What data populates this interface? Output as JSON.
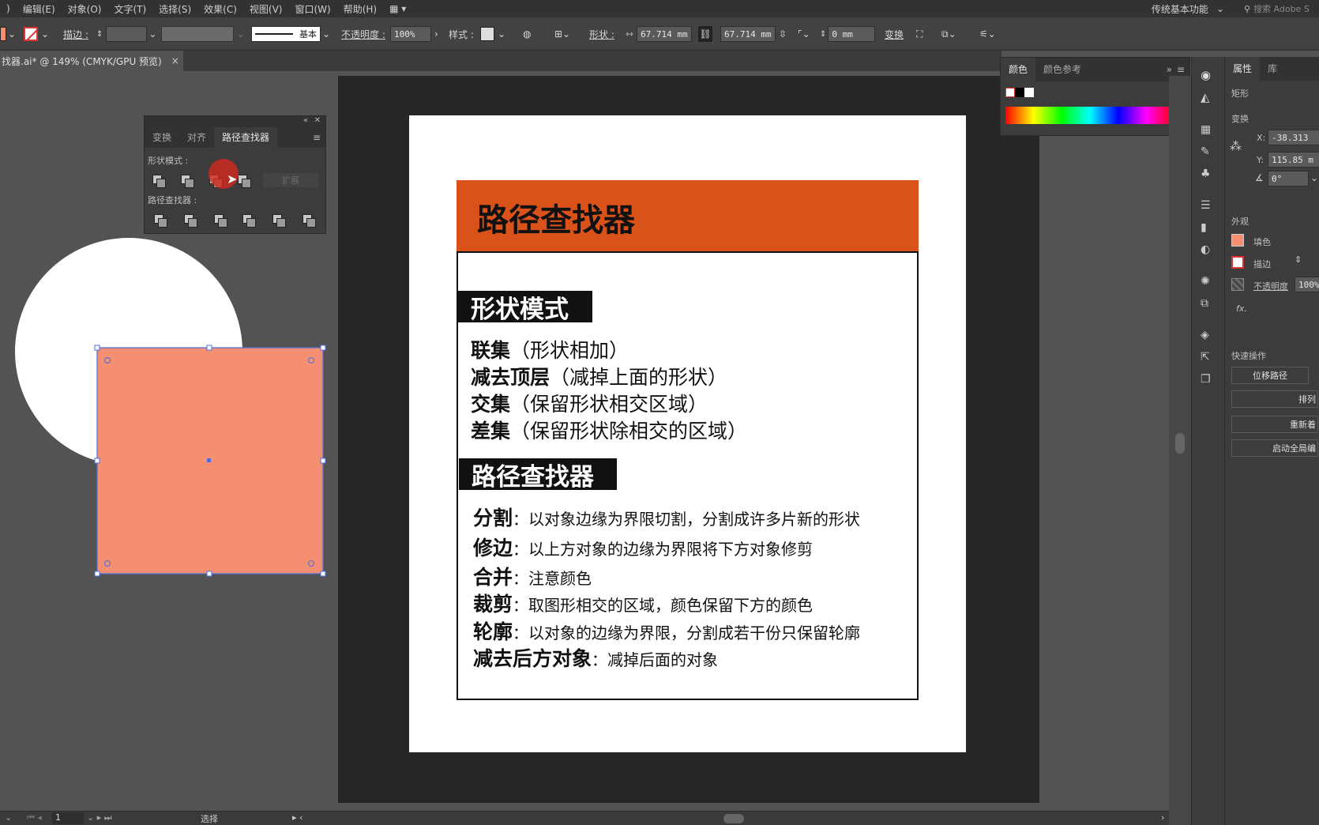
{
  "menubar": {
    "items": [
      ")",
      "编辑(E)",
      "对象(O)",
      "文字(T)",
      "选择(S)",
      "效果(C)",
      "视图(V)",
      "窗口(W)",
      "帮助(H)"
    ],
    "workspace": "传统基本功能",
    "search_placeholder": "搜索 Adobe S"
  },
  "controlbar": {
    "stroke_label": "描边 :",
    "stroke_style": "基本",
    "opacity_label": "不透明度 :",
    "opacity_value": "100%",
    "style_label": "样式 :",
    "shape_label": "形状 :",
    "width": "67.714 mm",
    "height": "67.714 mm",
    "corner": "0 mm",
    "transform_label": "变换"
  },
  "doc_tab": {
    "title": "找器.ai* @ 149% (CMYK/GPU 预览)",
    "close": "×"
  },
  "artboard": {
    "header": "路径查找器",
    "section1_title": "形状模式",
    "shape_modes": [
      {
        "term": "联集",
        "desc": "（形状相加）"
      },
      {
        "term": "减去顶层",
        "desc": "（减掉上面的形状）"
      },
      {
        "term": "交集",
        "desc": "（保留形状相交区域）"
      },
      {
        "term": "差集",
        "desc": "（保留形状除相交的区域）"
      }
    ],
    "section2_title": "路径查找器",
    "pathfinders": [
      {
        "term": "分割",
        "desc": "：以对象边缘为界限切割，分割成许多片新的形状"
      },
      {
        "term": "修边",
        "desc": "：以上方对象的边缘为界限将下方对象修剪"
      },
      {
        "term": "合并",
        "desc": "：注意颜色"
      },
      {
        "term": "裁剪",
        "desc": "：取图形相交的区域，颜色保留下方的颜色"
      },
      {
        "term": "轮廓",
        "desc": "：以对象的边缘为界限，分割成若干份只保留轮廓"
      },
      {
        "term": "减去后方对象",
        "desc": "：减掉后面的对象"
      }
    ]
  },
  "pathfinder_panel": {
    "tabs": [
      "变换",
      "对齐",
      "路径查找器"
    ],
    "active_tab": 2,
    "shape_modes_label": "形状模式 :",
    "expand_label": "扩展",
    "pathfinders_label": "路径查找器 :"
  },
  "color_panel": {
    "tabs": [
      "颜色",
      "颜色参考"
    ]
  },
  "properties": {
    "tabs": [
      "属性",
      "库"
    ],
    "object_type": "矩形",
    "transform_label": "变换",
    "x_label": "X:",
    "x_value": "-38.313",
    "y_label": "Y:",
    "y_value": "115.85 m",
    "angle_value": "0°",
    "appearance_label": "外观",
    "fill_label": "填色",
    "stroke_label": "描边",
    "opacity_label": "不透明度",
    "opacity_value": "100%",
    "fx_label": "fx.",
    "quick_actions_label": "快速操作",
    "btn_offset": "位移路径",
    "btn_arrange": "排列",
    "btn_recolor": "重新着",
    "btn_global": "启动全局编"
  },
  "statusbar": {
    "page": "1",
    "mode": "选择"
  },
  "colors": {
    "orange_header": "#d95219",
    "salmon_rect": "#f48f72",
    "selection": "#4a6ee0"
  }
}
